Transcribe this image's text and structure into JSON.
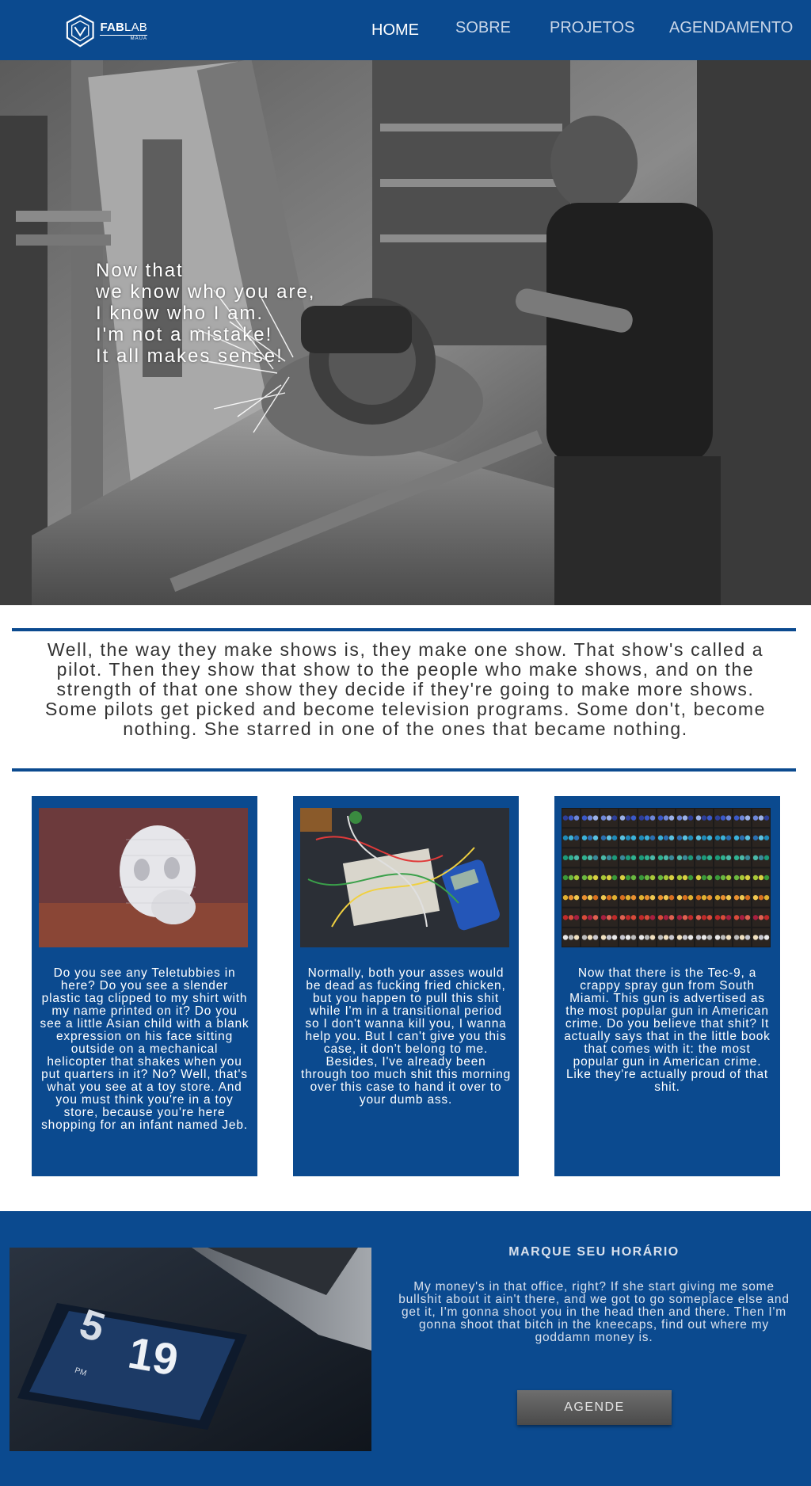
{
  "brand": {
    "logo_main_bold": "FAB",
    "logo_main_light": "LAB",
    "logo_sub": "MAUA"
  },
  "nav": {
    "items": [
      "HOME",
      "SOBRE",
      "PROJETOS",
      "AGENDAMENTO"
    ],
    "active": "HOME"
  },
  "hero": {
    "quote_lines": [
      "Now that",
      "we know who you are,",
      "I know who I am.",
      "I'm not a mistake!",
      "It all makes sense!"
    ]
  },
  "intro": {
    "text": "Well, the way they make shows is, they make one show. That show's called a pilot. Then they show that show to the people who make shows, and on the strength of that one show they decide if they're going to make more shows. Some pilots get picked and become television programs. Some don't, become nothing. She starred in one of the ones that became nothing."
  },
  "cards": [
    {
      "image": "3d-printed-skull-photo",
      "text": "Do you see any Teletubbies in here? Do you see a slender plastic tag clipped to my shirt with my name printed on it? Do you see a little Asian child with a blank expression on his face sitting outside on a mechanical helicopter that shakes when you put quarters in it? No? Well, that's what you see at a toy store. And you must think you're in a toy store, because you're here shopping for an infant named Jeb."
    },
    {
      "image": "electronics-breadboard-photo",
      "text": "Normally, both your asses would be dead as fucking fried chicken, but you happen to pull this shit while I'm in a transitional period so I don't wanna kill you, I wanna help you. But I can't give you this case, it don't belong to me. Besides, I've already been through too much shit this morning over this case to hand it over to your dumb ass."
    },
    {
      "image": "colorful-spools-photo",
      "text": "Now that there is the Tec-9, a crappy spray gun from South Miami. This gun is advertised as the most popular gun in American crime. Do you believe that shit? It actually says that in the little book that comes with it: the most popular gun in American crime. Like they're actually proud of that shit."
    }
  ],
  "booking": {
    "title": "MARQUE SEU HORÁRIO",
    "text": "My money's in that office, right? If she start giving me some bullshit about it ain't there, and we got to go someplace else and get it, I'm gonna shoot you in the head then and there. Then I'm gonna shoot that bitch in the kneecaps, find out where my goddamn money is.",
    "button": "AGENDE",
    "phone_clock_text": {
      "hour": "5",
      "minute": "19",
      "ampm": "PM"
    }
  },
  "colors": {
    "primary": "#0b4a8f",
    "button": "#5a5a5a",
    "white": "#ffffff"
  }
}
